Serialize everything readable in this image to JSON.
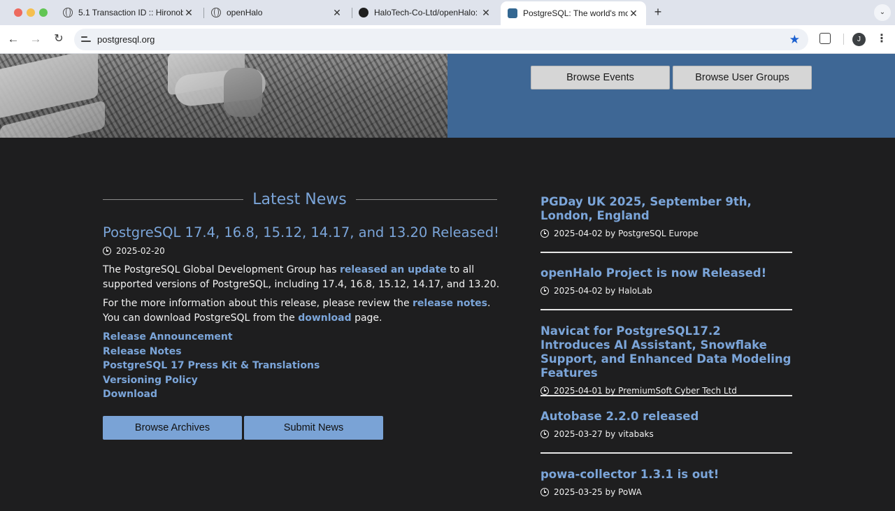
{
  "browser": {
    "tabs": [
      {
        "title": "5.1 Transaction ID :: Hironobu",
        "icon": "globe-icon"
      },
      {
        "title": "openHalo",
        "icon": "globe-icon"
      },
      {
        "title": "HaloTech-Co-Ltd/openHalo: o",
        "icon": "github-icon"
      },
      {
        "title": "PostgreSQL: The world's mo",
        "icon": "postgresql-elephant-icon",
        "active": true
      }
    ],
    "url": "postgresql.org",
    "profile_initial": "J"
  },
  "hero": {
    "browse_events": "Browse Events",
    "browse_user_groups": "Browse User Groups"
  },
  "latest_news": {
    "heading": "Latest News",
    "title": "PostgreSQL 17.4, 16.8, 15.12, 14.17, and 13.20 Released!",
    "date": "2025-02-20",
    "para1_a": "The PostgreSQL Global Development Group has ",
    "para1_link": "released an update",
    "para1_b": " to all supported versions of PostgreSQL, including 17.4, 16.8, 15.12, 14.17, and 13.20.",
    "para2_a": "For the more information about this release, please review the ",
    "para2_link1": "release notes",
    "para2_b": ". You can download PostgreSQL from the ",
    "para2_link2": "download",
    "para2_c": " page.",
    "links": [
      "Release Announcement",
      "Release Notes",
      "PostgreSQL 17 Press Kit & Translations",
      "Versioning Policy",
      "Download"
    ],
    "browse_archives": "Browse Archives",
    "submit_news": "Submit News"
  },
  "planet": [
    {
      "title": "PGDay UK 2025, September 9th, London, England",
      "meta": "2025-04-02 by PostgreSQL Europe"
    },
    {
      "title": "openHalo Project is now Released!",
      "meta": "2025-04-02 by HaloLab"
    },
    {
      "title": "Navicat for PostgreSQL17.2 Introduces AI Assistant, Snowflake Support, and Enhanced Data Modeling Features",
      "meta": "2025-04-01 by PremiumSoft Cyber Tech Ltd"
    },
    {
      "title": "Autobase 2.2.0 released",
      "meta": "2025-03-27 by vitabaks"
    },
    {
      "title": "powa-collector 1.3.1 is out!",
      "meta": "2025-03-25 by PoWA"
    }
  ],
  "colors": {
    "link": "#7ba5d9",
    "hero_blue": "#3e6795",
    "page_bg": "#1e1e1f",
    "button_blue": "#7aa3d6"
  }
}
